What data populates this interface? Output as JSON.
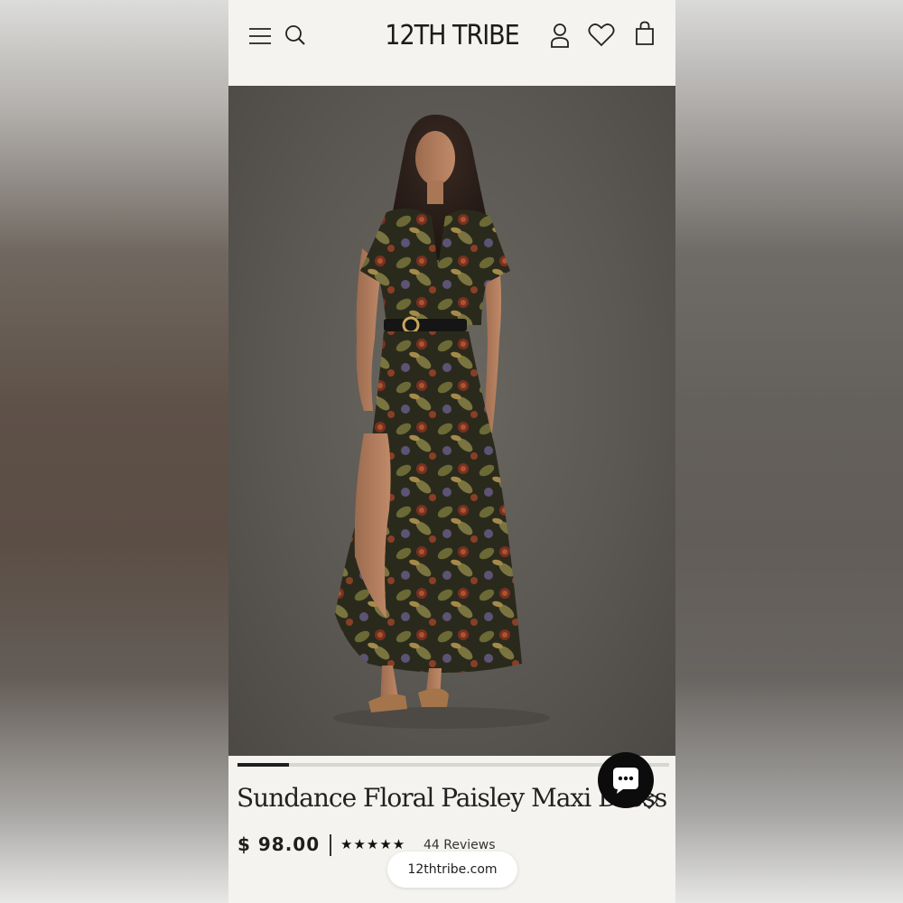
{
  "header": {
    "brand": "12TH TRIBE",
    "icons": [
      "menu-icon",
      "search-icon",
      "account-icon",
      "wishlist-icon",
      "bag-icon"
    ]
  },
  "gallery": {
    "progress": 0.12
  },
  "product": {
    "title": "Sundance Floral Paisley Maxi Dress",
    "price": "$ 98.00",
    "rating_stars": "★★★★★",
    "rating": 5,
    "reviews": "44 Reviews"
  },
  "chat": {
    "icon": "chat-icon"
  },
  "browser": {
    "url": "12thtribe.com"
  },
  "colors": {
    "page_bg": "#f4f3ef",
    "text": "#1e1e1e",
    "hero_bg": "#5b5853",
    "chat_bg": "#0c0c0c"
  }
}
